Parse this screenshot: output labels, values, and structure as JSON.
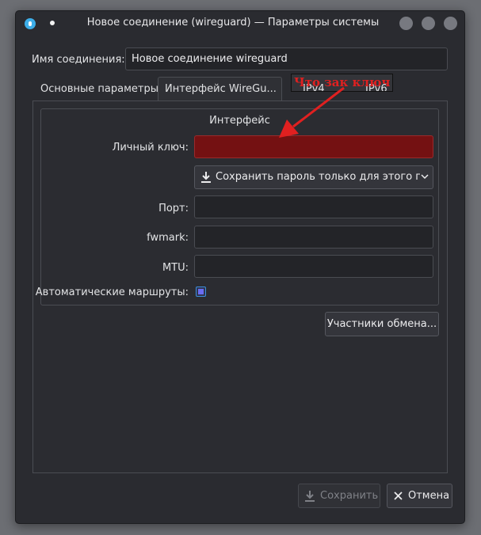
{
  "window": {
    "title": "Новое соединение (wireguard) — Параметры системы"
  },
  "connection": {
    "name_label": "Имя соединения:",
    "name_value": "Новое соединение wireguard"
  },
  "tabs": [
    {
      "label": "Основные параметры",
      "active": false
    },
    {
      "label": "Интерфейс WireGu...",
      "active": true
    },
    {
      "label": "IPv4",
      "active": false
    },
    {
      "label": "IPv6",
      "active": false
    }
  ],
  "interface_group": {
    "title": "Интерфейс",
    "private_key_label": "Личный ключ:",
    "private_key_value": "",
    "password_store_option": "Сохранить пароль только для этого польз",
    "port_label": "Порт:",
    "port_value": "",
    "fwmark_label": "fwmark:",
    "fwmark_value": "",
    "mtu_label": "MTU:",
    "mtu_value": "",
    "auto_routes_label": "Автоматические маршруты:",
    "auto_routes_checked": true
  },
  "peers_button": "Участники обмена...",
  "footer": {
    "save_label": "Сохранить",
    "cancel_label": "Отмена"
  },
  "annotation": {
    "text": "Что зак ключ",
    "color": "#e02020"
  },
  "colors": {
    "accent": "#3daee9",
    "error_field": "#741112"
  },
  "icons": {
    "app": "network-connect-icon",
    "pin": "pin-icon",
    "download": "download-icon",
    "chevron": "chevron-down-icon",
    "close": "close-icon"
  }
}
